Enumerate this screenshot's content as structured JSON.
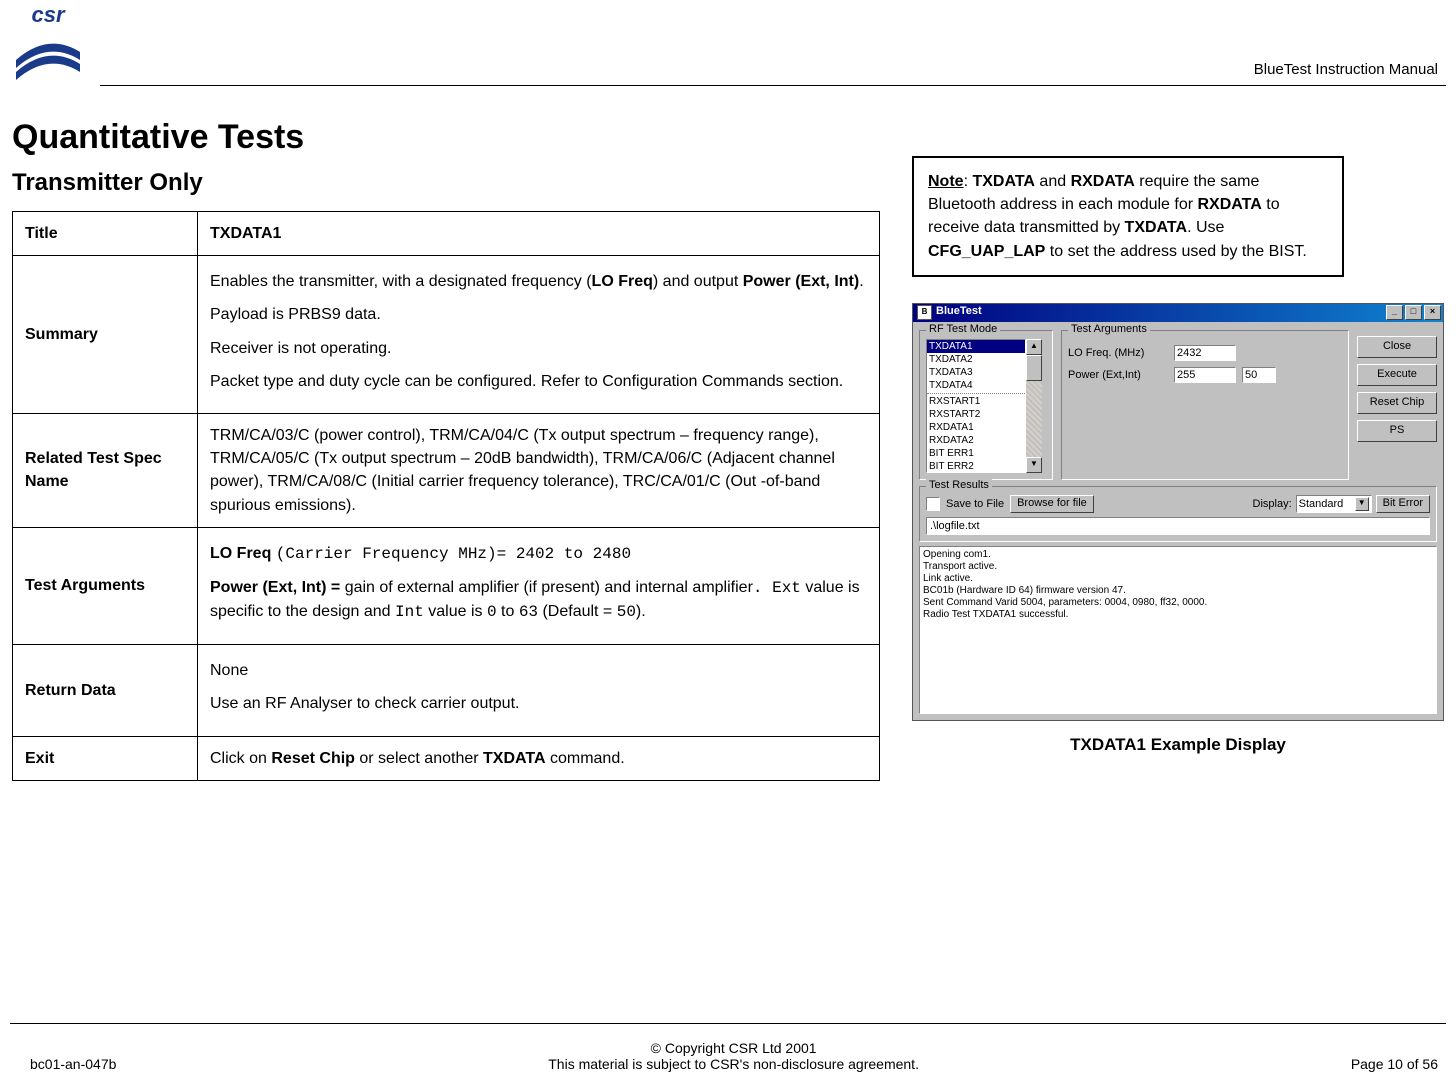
{
  "header": {
    "manual_title": "BlueTest Instruction Manual",
    "logo_text": "csr"
  },
  "main": {
    "h1": "Quantitative Tests",
    "h2": "Transmitter Only"
  },
  "table": {
    "title_label": "Title",
    "title_value": "TXDATA1",
    "summary_label": "Summary",
    "summary_p1_a": "Enables the transmitter, with a designated frequency  (",
    "summary_p1_b": "LO Freq",
    "summary_p1_c": ")  and output ",
    "summary_p1_d": "Power (Ext, Int)",
    "summary_p1_e": ".",
    "summary_p2": "Payload is PRBS9 data.",
    "summary_p3": "Receiver is not operating.",
    "summary_p4": "Packet type and duty cycle can be configured. Refer to Configuration Commands section.",
    "related_label": "Related Test Spec Name",
    "related_value": "TRM/CA/03/C (power control), TRM/CA/04/C (Tx output spectrum – frequency range), TRM/CA/05/C (Tx output spectrum – 20dB bandwidth), TRM/CA/06/C (Adjacent channel power), TRM/CA/08/C (Initial carrier frequency tolerance), TRC/CA/01/C (Out -of-band spurious emissions).",
    "args_label": "Test Arguments",
    "args_p1_a": "LO Freq ",
    "args_p1_b": "(Carrier Frequency MHz)= 2402 to 2480",
    "args_p2_a": "Power (Ext, Int) =",
    "args_p2_b": " gain of external amplifier (if present) and internal amplifier",
    "args_p2_c": ".   Ext",
    "args_p2_d": " value is specific to the design and  ",
    "args_p2_e": "Int",
    "args_p2_f": "  value is ",
    "args_p2_g": "0",
    "args_p2_h": " to ",
    "args_p2_i": "63",
    "args_p2_j": " (Default = ",
    "args_p2_k": "50",
    "args_p2_l": ").",
    "return_label": "Return Data",
    "return_p1": "None",
    "return_p2": "Use an RF Analyser to check carrier output.",
    "exit_label": "Exit",
    "exit_a": "Click on ",
    "exit_b": "Reset Chip",
    "exit_c": " or select another ",
    "exit_d": "TXDATA",
    "exit_e": " command."
  },
  "note": {
    "lead": "Note",
    "a": ": ",
    "b": "TXDATA",
    "c": " and ",
    "d": "RXDATA",
    "e": " require the same Bluetooth address in each module for ",
    "f": "RXDATA",
    "g": " to receive data transmitted by ",
    "h": "TXDATA",
    "i": ". Use ",
    "j": "CFG_UAP_LAP",
    "k": " to set the address used by the BIST."
  },
  "caption": "TXDATA1 Example Display",
  "app": {
    "title": "BlueTest",
    "group_mode": "RF Test Mode",
    "group_args": "Test Arguments",
    "list": [
      "TXDATA1",
      "TXDATA2",
      "TXDATA3",
      "TXDATA4",
      "RXSTART1",
      "RXSTART2",
      "RXDATA1",
      "RXDATA2",
      "BIT ERR1",
      "BIT ERR2"
    ],
    "lo_label": "LO Freq. (MHz)",
    "lo_value": "2432",
    "pwr_label": "Power (Ext,Int)",
    "pwr_ext": "255",
    "pwr_int": "50",
    "btn_close": "Close",
    "btn_exec": "Execute",
    "btn_reset": "Reset Chip",
    "btn_ps": "PS",
    "results_title": "Test Results",
    "save_label": "Save to File",
    "browse": "Browse for file",
    "display_label": "Display:",
    "display_sel": "Standard",
    "biterr": "Bit Error",
    "path": ".\\logfile.txt",
    "log": [
      "Opening com1.",
      "Transport active.",
      "Link active.",
      "BC01b (Hardware ID 64) firmware version 47.",
      "Sent Command Varid 5004, parameters: 0004, 0980, ff32, 0000.",
      "Radio Test TXDATA1 successful."
    ]
  },
  "footer": {
    "doc_id": "bc01-an-047b",
    "copyright": "© Copyright CSR Ltd 2001",
    "nda": "This material is subject to CSR's non-disclosure agreement.",
    "page": "Page 10 of 56"
  }
}
